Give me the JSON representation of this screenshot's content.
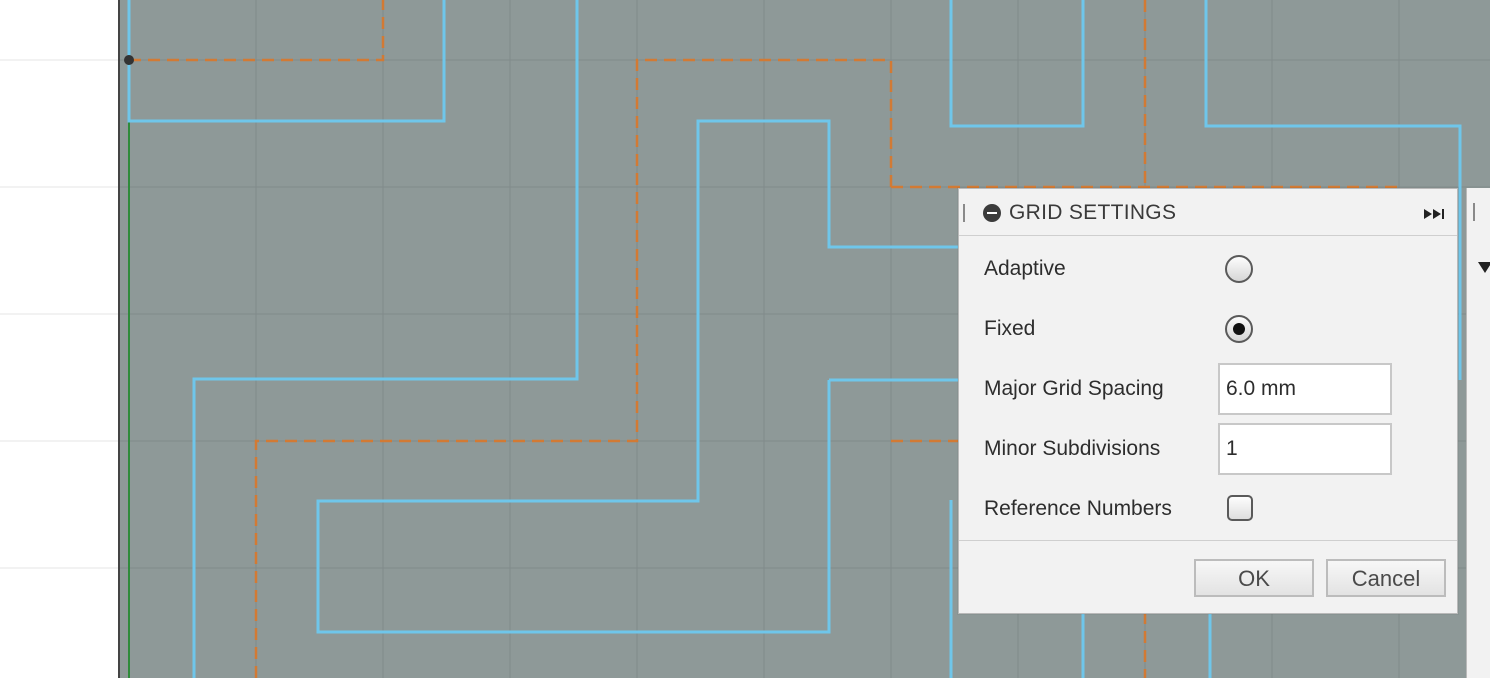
{
  "grid_settings": {
    "title": "GRID SETTINGS",
    "adaptive_label": "Adaptive",
    "adaptive_selected": false,
    "fixed_label": "Fixed",
    "fixed_selected": true,
    "major_spacing_label": "Major Grid Spacing",
    "major_spacing_value": "6.0 mm",
    "minor_subdivisions_label": "Minor Subdivisions",
    "minor_subdivisions_value": "1",
    "reference_numbers_label": "Reference Numbers",
    "reference_numbers_checked": false,
    "ok_label": "OK",
    "cancel_label": "Cancel"
  },
  "colors": {
    "canvas_gray": "#8e9998",
    "path_blue": "#6fc6ea",
    "path_orange": "#d27a34",
    "axis_green": "#2e8b3a"
  }
}
